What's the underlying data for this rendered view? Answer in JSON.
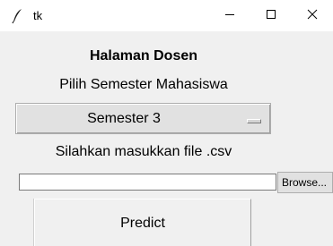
{
  "window": {
    "title": "tk",
    "icon": "feather-icon",
    "controls": {
      "minimize_icon": "minimize-icon",
      "maximize_icon": "maximize-icon",
      "close_icon": "close-icon"
    }
  },
  "main": {
    "heading": "Halaman Dosen",
    "semester_label": "Pilih Semester Mahasiswa",
    "semester_select": {
      "selected": "Semester 3"
    },
    "upload_label": "Silahkan masukkan file .csv",
    "file_input": {
      "value": ""
    },
    "browse_button": "Browse...",
    "predict_button": "Predict"
  }
}
